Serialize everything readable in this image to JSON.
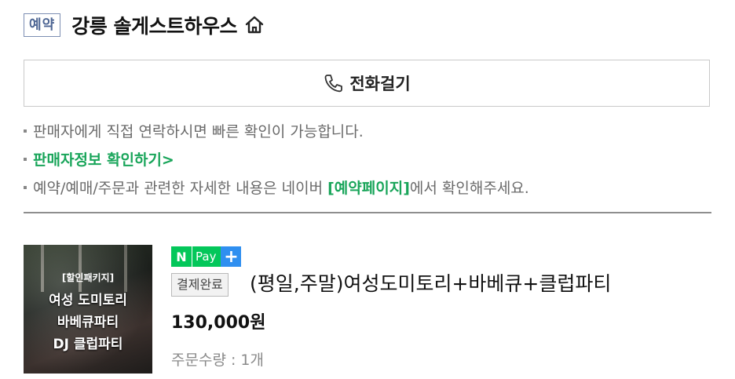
{
  "header": {
    "badge": "예약",
    "shop_name": "강릉 솔게스트하우스",
    "home_icon": "home-icon"
  },
  "call_button": {
    "label": "전화걸기",
    "icon": "phone-icon"
  },
  "notices": [
    {
      "text": "판매자에게 직접 연락하시면 빠른 확인이 가능합니다."
    },
    {
      "link_text": "판매자정보 확인하기>"
    },
    {
      "prefix": "예약/예매/주문과 관련한 자세한 내용은 네이버 ",
      "link_text": "[예약페이지]",
      "suffix": "에서 확인해주세요."
    }
  ],
  "product": {
    "thumbnail": {
      "small_text": "[할인패키지]",
      "lines": [
        "여성 도미토리",
        "바베큐파티",
        "DJ 클럽파티"
      ]
    },
    "npay": {
      "n": "N",
      "pay": "Pay",
      "plus": "+"
    },
    "status": "결제완료",
    "title": "(평일,주말)여성도미토리+바베큐+클럽파티",
    "price": "130,000원",
    "quantity": "주문수량 : 1개"
  },
  "colors": {
    "accent_green": "#19a55a",
    "npay_green": "#03c75a",
    "npay_blue": "#2f8ff0",
    "badge_blue": "#4e6694"
  }
}
